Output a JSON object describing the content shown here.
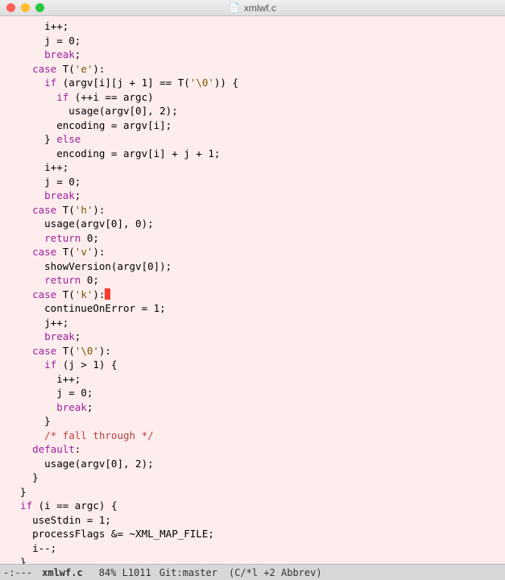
{
  "window": {
    "filename": "xmlwf.c",
    "file_icon": "📄"
  },
  "code": {
    "l1": "      i++;",
    "l2": "      j = 0;",
    "l3_kw1": "      break",
    "l3_rest": ";",
    "l4_kw1": "    case",
    "l4_mid": " T(",
    "l4_str": "'e'",
    "l4_end": "):",
    "l5_kw1": "      if",
    "l5_mid": " (argv[i][j + 1] == T(",
    "l5_str": "'\\0'",
    "l5_end": ")) {",
    "l6_kw1": "        if",
    "l6_rest": " (++i == argc)",
    "l7": "          usage(argv[0], 2);",
    "l8": "        encoding = argv[i];",
    "l9a": "      } ",
    "l9_kw": "else",
    "l10": "        encoding = argv[i] + j + 1;",
    "l11": "      i++;",
    "l12": "      j = 0;",
    "l13_kw": "      break",
    "l13_rest": ";",
    "l14_kw": "    case",
    "l14_mid": " T(",
    "l14_str": "'h'",
    "l14_end": "):",
    "l15": "      usage(argv[0], 0);",
    "l16_kw": "      return",
    "l16_rest": " 0;",
    "l17_kw": "    case",
    "l17_mid": " T(",
    "l17_str": "'v'",
    "l17_end": "):",
    "l18": "      showVersion(argv[0]);",
    "l19_kw": "      return",
    "l19_rest": " 0;",
    "l20_kw": "    case",
    "l20_mid": " T(",
    "l20_str": "'k'",
    "l20_end": "):",
    "l21": "      continueOnError = 1;",
    "l22": "      j++;",
    "l23_kw": "      break",
    "l23_rest": ";",
    "l24_kw": "    case",
    "l24_mid": " T(",
    "l24_str": "'\\0'",
    "l24_end": "):",
    "l25_kw": "      if",
    "l25_rest": " (j > 1) {",
    "l26": "        i++;",
    "l27": "        j = 0;",
    "l28_kw": "        break",
    "l28_rest": ";",
    "l29": "      }",
    "l30_cmt": "      /* fall through */",
    "l31_kw": "    default",
    "l31_rest": ":",
    "l32": "      usage(argv[0], 2);",
    "l33": "    }",
    "l34": "  }",
    "l35_kw": "  if",
    "l35_rest": " (i == argc) {",
    "l36": "    useStdin = 1;",
    "l37": "    processFlags &= ~XML_MAP_FILE;",
    "l38": "    i--;",
    "l39": "  }"
  },
  "statusbar": {
    "left": "-:---",
    "filename": "xmlwf.c",
    "position": "84% L1011",
    "git": "Git:master",
    "mode": "(C/*l +2 Abbrev)"
  }
}
